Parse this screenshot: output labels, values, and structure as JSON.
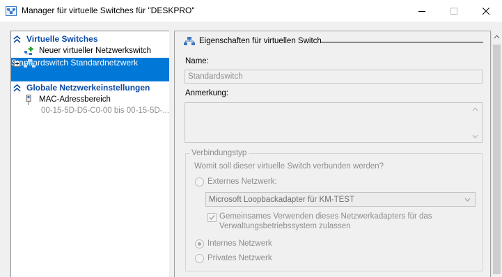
{
  "window": {
    "title": "Manager für virtuelle Switches für \"DESKPRO\"",
    "controls": {
      "minimize": "minimize-icon",
      "maximize": "maximize-icon",
      "close": "close-icon"
    }
  },
  "sidebar": {
    "section_virtual_switches": "Virtuelle Switches",
    "new_switch": "Neuer virtueller Netzwerkswitch",
    "selected_switch": {
      "name": "Standardswitch",
      "network": "Standardnetzwerk"
    },
    "section_global": "Globale Netzwerkeinstellungen",
    "mac_range": {
      "label": "MAC-Adressbereich",
      "value": "00-15-5D-D5-C0-00 bis 00-15-5D-..."
    }
  },
  "properties": {
    "header": "Eigenschaften für virtuellen Switch",
    "name_label": "Name:",
    "name_value": "Standardswitch",
    "notes_label": "Anmerkung:",
    "notes_value": "",
    "connection_group": "Verbindungstyp",
    "connection_question": "Womit soll dieser virtuelle Switch verbunden werden?",
    "external_label": "Externes Netzwerk:",
    "adapter_selected": "Microsoft Loopbackadapter für KM-TEST",
    "share_label_line1": "Gemeinsames Verwenden dieses Netzwerkadapters für das",
    "share_label_line2": "Verwaltungsbetriebssystem zulassen",
    "internal_label": "Internes Netzwerk",
    "private_label": "Privates Netzwerk"
  },
  "colors": {
    "accent": "#0078d7",
    "section_header": "#0a4aa6",
    "disabled_text": "#8d8d8d"
  }
}
